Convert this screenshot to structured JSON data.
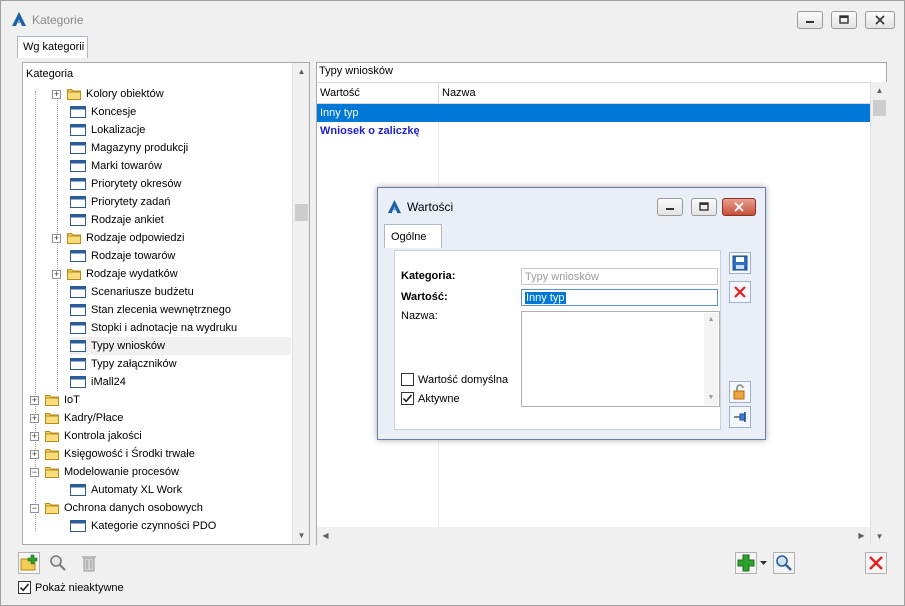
{
  "window": {
    "title": "Kategorie",
    "tab_label": "Wg kategorii"
  },
  "tree": {
    "header": "Kategoria",
    "rows": [
      {
        "label": "Kolory obiektów",
        "type": "folder",
        "expander": "+"
      },
      {
        "label": "Koncesje",
        "type": "table"
      },
      {
        "label": "Lokalizacje",
        "type": "table"
      },
      {
        "label": "Magazyny produkcji",
        "type": "table"
      },
      {
        "label": "Marki towarów",
        "type": "table"
      },
      {
        "label": "Priorytety okresów",
        "type": "table"
      },
      {
        "label": "Priorytety zadań",
        "type": "table"
      },
      {
        "label": "Rodzaje ankiet",
        "type": "table"
      },
      {
        "label": "Rodzaje odpowiedzi",
        "type": "folder",
        "expander": "+"
      },
      {
        "label": "Rodzaje towarów",
        "type": "table"
      },
      {
        "label": "Rodzaje wydatków",
        "type": "folder",
        "expander": "+"
      },
      {
        "label": "Scenariusze budżetu",
        "type": "table"
      },
      {
        "label": "Stan zlecenia wewnętrznego",
        "type": "table"
      },
      {
        "label": "Stopki i adnotacje na wydruku",
        "type": "table"
      },
      {
        "label": "Typy wniosków",
        "type": "table",
        "selected": true
      },
      {
        "label": "Typy załączników",
        "type": "table"
      },
      {
        "label": "iMall24",
        "type": "table"
      },
      {
        "label": "IoT",
        "type": "folder",
        "expander": "+",
        "level": 0
      },
      {
        "label": "Kadry/Płace",
        "type": "folder",
        "expander": "+",
        "level": 0
      },
      {
        "label": "Kontrola jakości",
        "type": "folder",
        "expander": "+",
        "level": 0
      },
      {
        "label": "Księgowość i Środki trwałe",
        "type": "folder",
        "expander": "+",
        "level": 0
      },
      {
        "label": "Modelowanie procesów",
        "type": "folder",
        "expander": "−",
        "level": 0
      },
      {
        "label": "Automaty XL Work",
        "type": "table"
      },
      {
        "label": "Ochrona danych osobowych",
        "type": "folder",
        "expander": "−",
        "level": 0
      },
      {
        "label": "Kategorie czynności PDO",
        "type": "table"
      }
    ]
  },
  "right_panel": {
    "title": "Typy wniosków",
    "columns": [
      "Wartość",
      "Nazwa"
    ],
    "rows": [
      {
        "value": "Inny typ",
        "name": "",
        "selected": true
      },
      {
        "value": "Wniosek o zaliczkę",
        "name": "",
        "bold": true
      }
    ]
  },
  "footer": {
    "show_inactive_label": "Pokaż nieaktywne",
    "show_inactive_checked": true
  },
  "dialog": {
    "title": "Wartości",
    "tab_label": "Ogólne",
    "category_label": "Kategoria:",
    "category_value": "Typy wniosków",
    "value_label": "Wartość:",
    "value_value": "Inny typ",
    "name_label": "Nazwa:",
    "default_label": "Wartość domyślna",
    "default_checked": false,
    "active_label": "Aktywne",
    "active_checked": true
  },
  "colors": {
    "selection": "#0078d7",
    "bold_row": "#1f1fcc",
    "delete_red": "#e02020",
    "add_green": "#2ea02e"
  }
}
